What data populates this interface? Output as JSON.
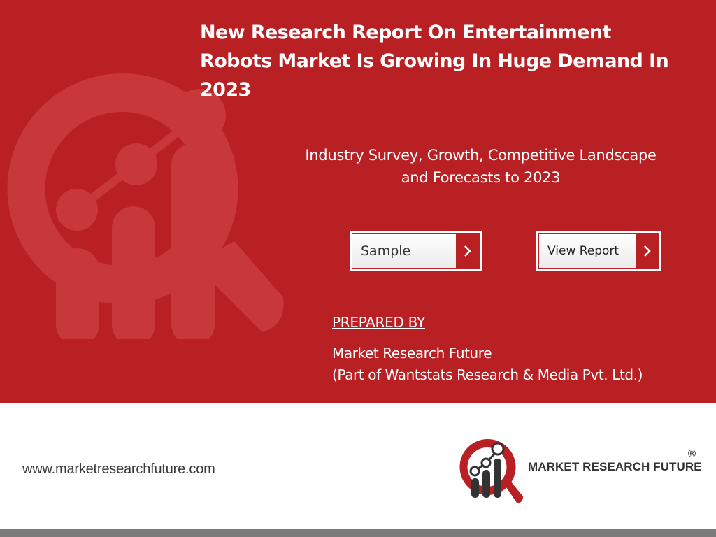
{
  "slide": {
    "title": "New Research Report On Entertainment Robots Market Is Growing In Huge Demand In 2023",
    "subtitle_line1": "Industry Survey, Growth, Competitive Landscape",
    "subtitle_line2": "and Forecasts to 2023"
  },
  "buttons": {
    "sample_label": "Sample",
    "view_report_label": "View Report",
    "arrow_icon": "chevron-right-icon"
  },
  "prepared": {
    "heading": "PREPARED BY",
    "company": "Market Research Future",
    "parent": "(Part of Wantstats Research & Media Pvt. Ltd.)"
  },
  "footer": {
    "url": "www.marketresearchfuture.com",
    "logo_text": "MARKET RESEARCH FUTURE",
    "registered_mark": "®"
  },
  "colors": {
    "brand_red": "#b82024",
    "watermark_red": "#c8383b",
    "footer_bar": "#7a7a7a",
    "logo_dark": "#333333"
  }
}
